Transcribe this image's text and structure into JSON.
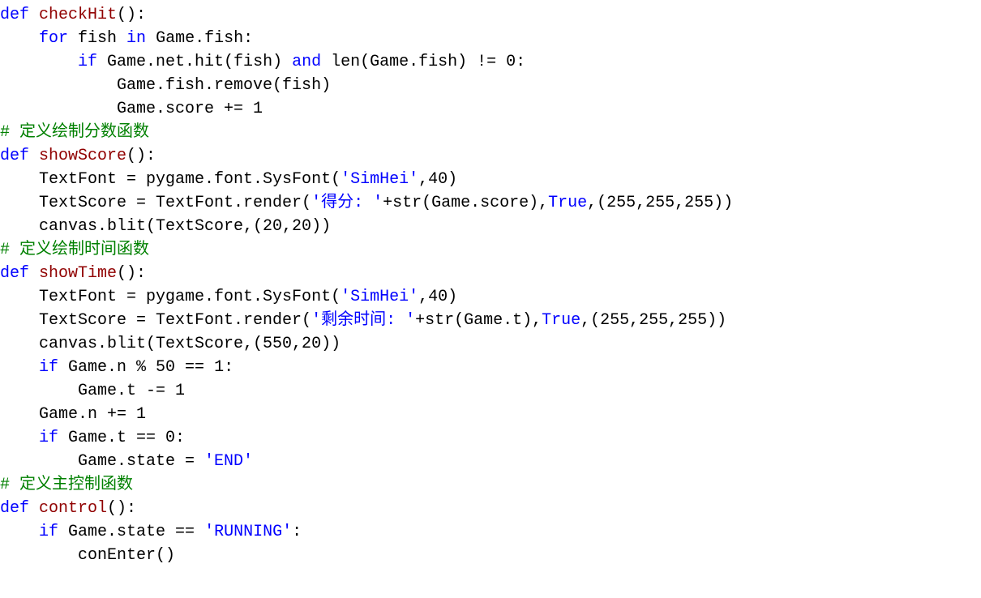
{
  "code": {
    "lines": [
      [
        {
          "cls": "kw",
          "t": "def "
        },
        {
          "cls": "fn",
          "t": "checkHit"
        },
        {
          "cls": "",
          "t": "():"
        }
      ],
      [
        {
          "cls": "",
          "t": "    "
        },
        {
          "cls": "kw",
          "t": "for"
        },
        {
          "cls": "",
          "t": " fish "
        },
        {
          "cls": "kw",
          "t": "in"
        },
        {
          "cls": "",
          "t": " Game.fish:"
        }
      ],
      [
        {
          "cls": "",
          "t": "        "
        },
        {
          "cls": "kw",
          "t": "if"
        },
        {
          "cls": "",
          "t": " Game.net.hit(fish) "
        },
        {
          "cls": "kw",
          "t": "and"
        },
        {
          "cls": "",
          "t": " len(Game.fish) != 0:"
        }
      ],
      [
        {
          "cls": "",
          "t": "            Game.fish.remove(fish)"
        }
      ],
      [
        {
          "cls": "",
          "t": "            Game.score += 1"
        }
      ],
      [
        {
          "cls": "cmt",
          "t": "# 定义绘制分数函数"
        }
      ],
      [
        {
          "cls": "kw",
          "t": "def "
        },
        {
          "cls": "fn",
          "t": "showScore"
        },
        {
          "cls": "",
          "t": "():"
        }
      ],
      [
        {
          "cls": "",
          "t": "    TextFont = pygame.font.SysFont("
        },
        {
          "cls": "str",
          "t": "'SimHei'"
        },
        {
          "cls": "",
          "t": ",40)"
        }
      ],
      [
        {
          "cls": "",
          "t": "    TextScore = TextFont.render("
        },
        {
          "cls": "str",
          "t": "'得分: '"
        },
        {
          "cls": "",
          "t": "+str(Game.score),"
        },
        {
          "cls": "const",
          "t": "True"
        },
        {
          "cls": "",
          "t": ",(255,255,255))"
        }
      ],
      [
        {
          "cls": "",
          "t": "    canvas.blit(TextScore,(20,20))"
        }
      ],
      [
        {
          "cls": "cmt",
          "t": "# 定义绘制时间函数"
        }
      ],
      [
        {
          "cls": "kw",
          "t": "def "
        },
        {
          "cls": "fn",
          "t": "showTime"
        },
        {
          "cls": "",
          "t": "():"
        }
      ],
      [
        {
          "cls": "",
          "t": "    TextFont = pygame.font.SysFont("
        },
        {
          "cls": "str",
          "t": "'SimHei'"
        },
        {
          "cls": "",
          "t": ",40)"
        }
      ],
      [
        {
          "cls": "",
          "t": "    TextScore = TextFont.render("
        },
        {
          "cls": "str",
          "t": "'剩余时间: '"
        },
        {
          "cls": "",
          "t": "+str(Game.t),"
        },
        {
          "cls": "const",
          "t": "True"
        },
        {
          "cls": "",
          "t": ",(255,255,255))"
        }
      ],
      [
        {
          "cls": "",
          "t": "    canvas.blit(TextScore,(550,20))"
        }
      ],
      [
        {
          "cls": "",
          "t": "    "
        },
        {
          "cls": "kw",
          "t": "if"
        },
        {
          "cls": "",
          "t": " Game.n % 50 == 1:"
        }
      ],
      [
        {
          "cls": "",
          "t": "        Game.t -= 1"
        }
      ],
      [
        {
          "cls": "",
          "t": "    Game.n += 1"
        }
      ],
      [
        {
          "cls": "",
          "t": "    "
        },
        {
          "cls": "kw",
          "t": "if"
        },
        {
          "cls": "",
          "t": " Game.t == 0:"
        }
      ],
      [
        {
          "cls": "",
          "t": "        Game.state = "
        },
        {
          "cls": "str",
          "t": "'END'"
        }
      ],
      [
        {
          "cls": "cmt",
          "t": "# 定义主控制函数"
        }
      ],
      [
        {
          "cls": "kw",
          "t": "def "
        },
        {
          "cls": "fn",
          "t": "control"
        },
        {
          "cls": "",
          "t": "():"
        }
      ],
      [
        {
          "cls": "",
          "t": "    "
        },
        {
          "cls": "kw",
          "t": "if"
        },
        {
          "cls": "",
          "t": " Game.state == "
        },
        {
          "cls": "str",
          "t": "'RUNNING'"
        },
        {
          "cls": "",
          "t": ":"
        }
      ],
      [
        {
          "cls": "",
          "t": "        conEnter()"
        }
      ]
    ]
  }
}
